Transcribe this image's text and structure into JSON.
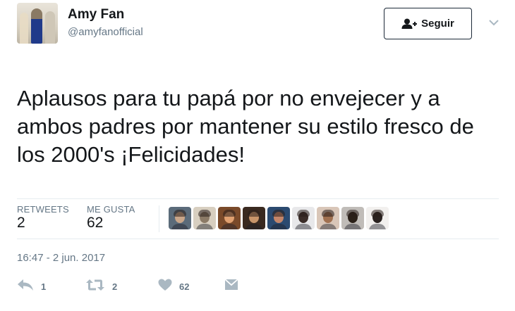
{
  "user": {
    "name": "Amy Fan",
    "handle": "@amyfanofficial"
  },
  "follow_button": {
    "label": "Seguir"
  },
  "tweet": {
    "text": "Aplausos para tu papá por no envejecer y a ambos padres por mantener su estilo fresco de los 2000's ¡Felicidades!"
  },
  "stats": {
    "retweets_label": "RETWEETS",
    "retweets_value": "2",
    "likes_label": "ME GUSTA",
    "likes_value": "62"
  },
  "likers": [
    {
      "name": "liker-1",
      "colors": [
        "#5b6b7a",
        "#c9a68a"
      ]
    },
    {
      "name": "liker-2",
      "colors": [
        "#d8cfc0",
        "#8b7a66"
      ]
    },
    {
      "name": "liker-3",
      "colors": [
        "#7a4a2a",
        "#e0a070"
      ]
    },
    {
      "name": "liker-4",
      "colors": [
        "#3a2a20",
        "#c8956a"
      ]
    },
    {
      "name": "liker-5",
      "colors": [
        "#2b4a70",
        "#c4866a"
      ]
    },
    {
      "name": "liker-6",
      "colors": [
        "#e8e8ea",
        "#3a2c28"
      ]
    },
    {
      "name": "liker-7",
      "colors": [
        "#d9c6b8",
        "#a07050"
      ]
    },
    {
      "name": "liker-8",
      "colors": [
        "#c0bcb8",
        "#2a2018"
      ]
    },
    {
      "name": "liker-9",
      "colors": [
        "#f2f0ee",
        "#2a2220"
      ]
    }
  ],
  "timestamp": "16:47 - 2 jun. 2017",
  "actions": {
    "reply_count": "1",
    "retweet_count": "2",
    "like_count": "62"
  },
  "icons": {
    "follow": "add-user-icon",
    "caret": "chevron-down-icon",
    "reply": "reply-icon",
    "retweet": "retweet-icon",
    "like": "heart-icon",
    "message": "envelope-icon"
  },
  "colors": {
    "text": "#14171a",
    "secondary_text": "#657786",
    "icon": "#aab8c2",
    "divider": "#e6ecf0"
  }
}
